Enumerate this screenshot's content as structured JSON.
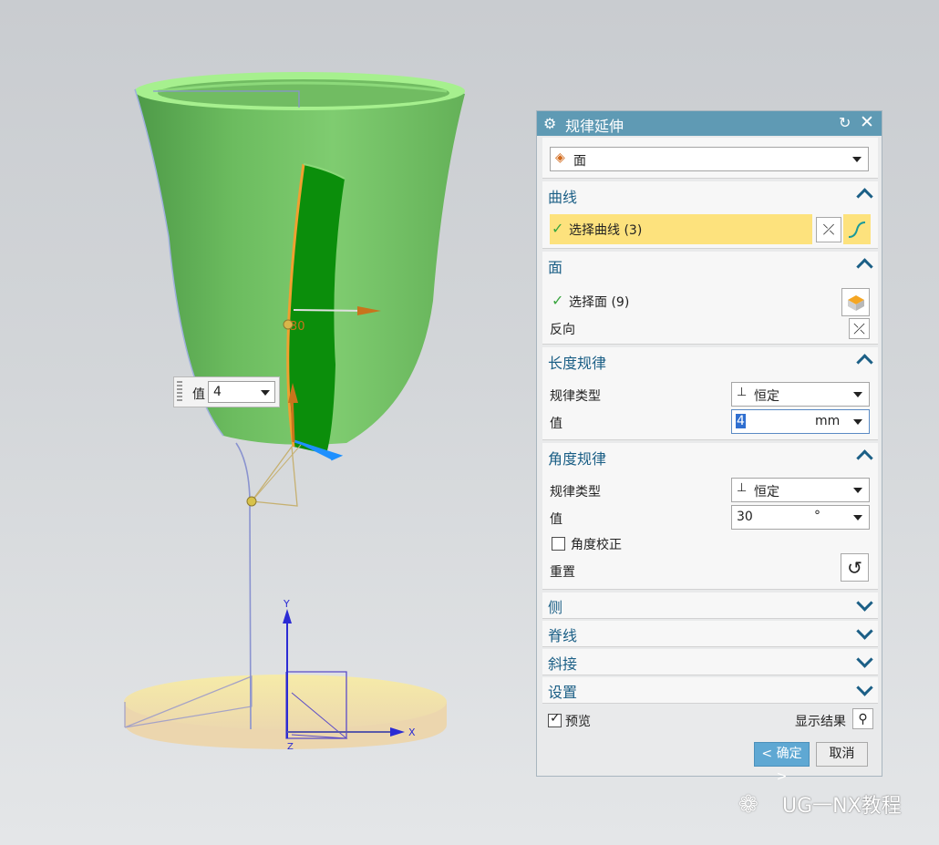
{
  "onscreen_input": {
    "label": "值",
    "value": "4"
  },
  "axes": {
    "x": "X",
    "y": "Y",
    "z": "Z"
  },
  "handle_label": "30",
  "dialog": {
    "title": "规律延伸",
    "type_select": "面",
    "curve_section": {
      "title": "曲线",
      "select_label": "选择曲线 (3)"
    },
    "face_section": {
      "title": "面",
      "select_label": "选择面 (9)",
      "reverse_label": "反向"
    },
    "length_law": {
      "title": "长度规律",
      "law_type_label": "规律类型",
      "law_type_value": "恒定",
      "value_label": "值",
      "value": "4",
      "unit": "mm"
    },
    "angle_law": {
      "title": "角度规律",
      "law_type_label": "规律类型",
      "law_type_value": "恒定",
      "value_label": "值",
      "value": "30",
      "unit": "°",
      "correction_label": "角度校正",
      "reset_label": "重置"
    },
    "collapsed_sections": [
      "侧",
      "脊线",
      "斜接",
      "设置"
    ],
    "preview_label": "预览",
    "show_result_label": "显示结果",
    "ok_label": "< 确定 >",
    "cancel_label": "取消"
  },
  "watermark": "UG一NX教程",
  "colors": {
    "title_bar": "#5f9ab4",
    "section_title": "#1b5f86",
    "highlight_row": "#fde27d",
    "model_green": "#73c164",
    "face_green": "#0d8f0d",
    "base": "#efdcaa"
  }
}
